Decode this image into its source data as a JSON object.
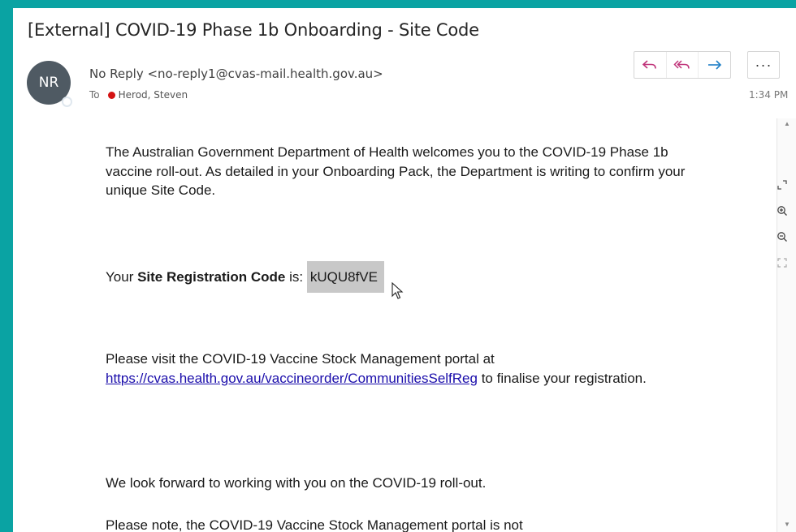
{
  "email": {
    "subject": "[External] COVID-19 Phase 1b Onboarding - Site Code",
    "avatar_initials": "NR",
    "sender": "No Reply <no-reply1@cvas-mail.health.gov.au>",
    "to_label": "To",
    "recipient": "Herod, Steven",
    "time": "1:34 PM",
    "more_label": "···"
  },
  "body": {
    "p1": "The Australian Government Department of Health welcomes you to the COVID-19 Phase 1b vaccine roll-out. As detailed in your Onboarding Pack, the Department is writing to confirm your unique Site Code.",
    "p2_prefix": "Your ",
    "p2_bold": "Site Registration Code",
    "p2_mid": " is: ",
    "p2_code": "kUQU8fVE",
    "p3_prefix": "Please visit the COVID-19 Vaccine Stock Management portal at ",
    "p3_link": "https://cvas.health.gov.au/vaccineorder/CommunitiesSelfReg",
    "p3_suffix": " to finalise your registration.",
    "p4": "We look forward to working with you on the COVID-19 roll-out.",
    "p5": "Please note, the COVID-19 Vaccine Stock Management portal is not"
  },
  "icons": {
    "reply": "reply-icon",
    "reply_all": "reply-all-icon",
    "forward": "forward-icon",
    "more": "more-icon",
    "expand": "expand-icon",
    "zoom_in": "zoom-in-icon",
    "zoom_out": "zoom-out-icon",
    "fit": "fit-icon"
  },
  "colors": {
    "frame": "#0aa3a3",
    "accent_icon": "#c0347a",
    "forward_icon": "#1e7fc6",
    "presence_dot": "#d41313",
    "link": "#1a0dab",
    "highlight": "#c8c8c8"
  }
}
